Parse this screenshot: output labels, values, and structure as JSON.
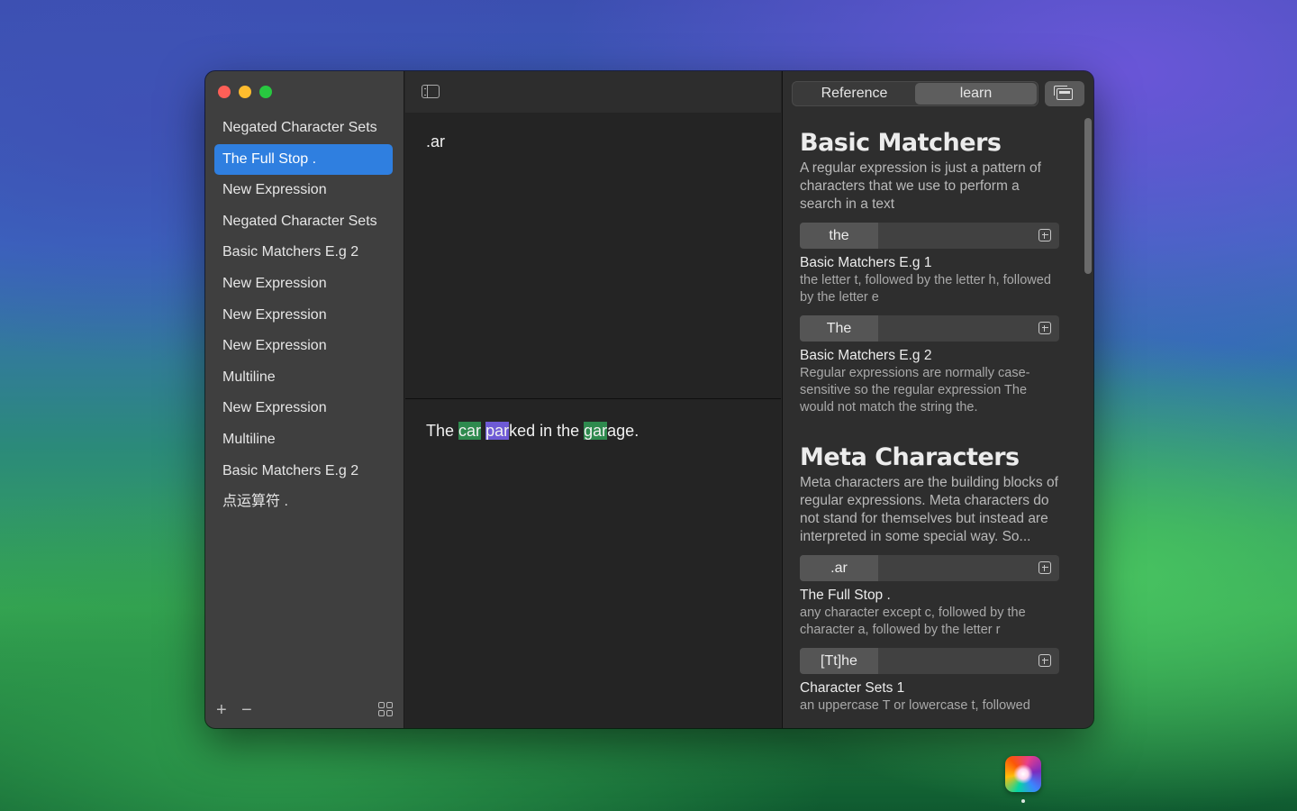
{
  "sidebar": {
    "items": [
      {
        "label": "Negated Character Sets",
        "selected": false
      },
      {
        "label": "The Full Stop .",
        "selected": true
      },
      {
        "label": "New Expression",
        "selected": false
      },
      {
        "label": "Negated Character Sets",
        "selected": false
      },
      {
        "label": "Basic Matchers E.g  2",
        "selected": false
      },
      {
        "label": "New Expression",
        "selected": false
      },
      {
        "label": "New Expression",
        "selected": false
      },
      {
        "label": "New Expression",
        "selected": false
      },
      {
        "label": "Multiline",
        "selected": false
      },
      {
        "label": "New Expression",
        "selected": false
      },
      {
        "label": "Multiline",
        "selected": false
      },
      {
        "label": "Basic Matchers E.g  2",
        "selected": false
      },
      {
        "label": "点运算符 .",
        "selected": false
      }
    ],
    "add_label": "+",
    "remove_label": "−"
  },
  "editor": {
    "expression": ".ar",
    "test_segments": [
      {
        "text": "The ",
        "hl": ""
      },
      {
        "text": "car",
        "hl": "green"
      },
      {
        "text": " ",
        "hl": ""
      },
      {
        "text": "par",
        "hl": "purple"
      },
      {
        "text": "ked in the ",
        "hl": ""
      },
      {
        "text": "gar",
        "hl": "green"
      },
      {
        "text": "age.",
        "hl": ""
      }
    ]
  },
  "reference_panel": {
    "tabs": [
      "Reference",
      "learn"
    ],
    "active_tab": "learn",
    "sections": [
      {
        "title": "Basic Matchers",
        "description": "A regular expression is just a pattern of characters that we use to perform a search in a text",
        "examples": [
          {
            "pattern": "the",
            "name": "Basic Matchers E.g 1",
            "desc": "the letter t, followed by the letter h, followed by the letter e"
          },
          {
            "pattern": "The",
            "name": "Basic Matchers E.g  2",
            "desc": "Regular expressions are normally case-sensitive so the regular expression The would not match the string the."
          }
        ]
      },
      {
        "title": "Meta Characters",
        "description": "Meta characters are the building blocks of regular expressions. Meta characters do not stand for themselves but instead are interpreted in some special way. So...",
        "examples": [
          {
            "pattern": ".ar",
            "name": "The Full Stop .",
            "desc": "any character except c, followed by the character a, followed by the letter r"
          },
          {
            "pattern": "[Tt]he",
            "name": "Character Sets 1",
            "desc": "an uppercase T or lowercase t, followed"
          }
        ]
      }
    ]
  },
  "colors": {
    "selection": "#2f7fe0",
    "match_green": "#2e8a4e",
    "match_purple": "#6e5ad6"
  },
  "icons": [
    "sidebar-toggle-icon",
    "window-stack-icon",
    "add-example-icon",
    "grid-icon",
    "app-dock-icon"
  ]
}
